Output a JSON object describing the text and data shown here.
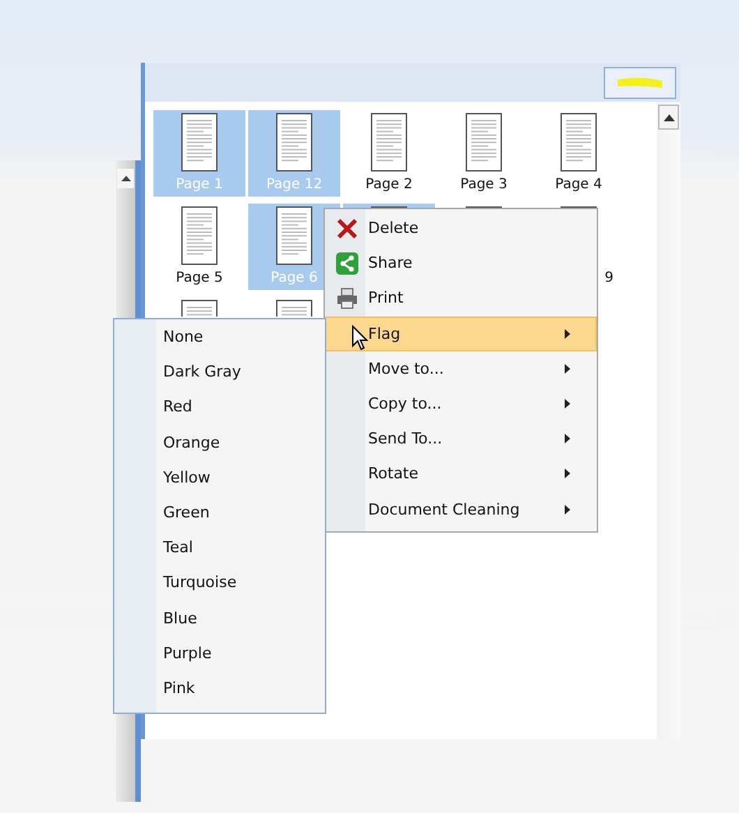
{
  "thumbnails": [
    {
      "label": "Page 1",
      "selected": true
    },
    {
      "label": "Page 12",
      "selected": true
    },
    {
      "label": "Page 2",
      "selected": false
    },
    {
      "label": "Page 3",
      "selected": false
    },
    {
      "label": "Page 4",
      "selected": false
    },
    {
      "label": "Page 5",
      "selected": false
    },
    {
      "label": "Page 6",
      "selected": true
    },
    {
      "selected": true
    },
    {
      "selected": false
    },
    {
      "label": "9",
      "selected": false
    },
    {
      "selected": false
    },
    {
      "selected": false
    }
  ],
  "context_menu": {
    "items": [
      {
        "label": "Delete",
        "submenu": false,
        "selected": false
      },
      {
        "label": "Share",
        "submenu": false,
        "selected": false
      },
      {
        "label": "Print",
        "submenu": false,
        "selected": false
      },
      {
        "label": "Flag",
        "submenu": true,
        "selected": true
      },
      {
        "label": "Move to...",
        "submenu": true,
        "selected": false
      },
      {
        "label": "Copy to...",
        "submenu": true,
        "selected": false
      },
      {
        "label": "Send To...",
        "submenu": true,
        "selected": false
      },
      {
        "label": "Rotate",
        "submenu": true,
        "selected": false
      },
      {
        "label": "Document Cleaning",
        "submenu": true,
        "selected": false
      }
    ]
  },
  "flag_submenu": {
    "items": [
      {
        "label": "None",
        "selected": false
      },
      {
        "label": "Dark Gray",
        "selected": false
      },
      {
        "label": "Red",
        "selected": false
      },
      {
        "label": "Orange",
        "selected": false
      },
      {
        "label": "Yellow",
        "selected": false
      },
      {
        "label": "Green",
        "selected": false
      },
      {
        "label": "Teal",
        "selected": false
      },
      {
        "label": "Turquoise",
        "selected": false
      },
      {
        "label": "Blue",
        "selected": false
      },
      {
        "label": "Purple",
        "selected": false
      },
      {
        "label": "Pink",
        "selected": false
      }
    ]
  }
}
